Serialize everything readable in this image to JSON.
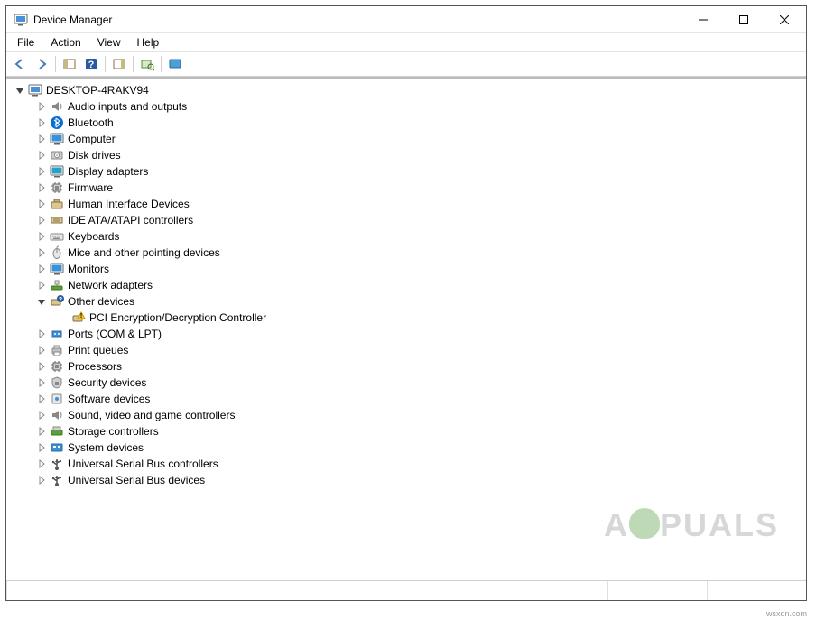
{
  "window": {
    "title": "Device Manager"
  },
  "menu": {
    "file": "File",
    "action": "Action",
    "view": "View",
    "help": "Help"
  },
  "tree": {
    "root": {
      "label": "DESKTOP-4RAKV94",
      "icon": "computer-root"
    },
    "categories": [
      {
        "label": "Audio inputs and outputs",
        "icon": "speaker",
        "expanded": false
      },
      {
        "label": "Bluetooth",
        "icon": "bluetooth",
        "expanded": false
      },
      {
        "label": "Computer",
        "icon": "monitor",
        "expanded": false
      },
      {
        "label": "Disk drives",
        "icon": "disk",
        "expanded": false
      },
      {
        "label": "Display adapters",
        "icon": "display",
        "expanded": false
      },
      {
        "label": "Firmware",
        "icon": "chip",
        "expanded": false
      },
      {
        "label": "Human Interface Devices",
        "icon": "hid",
        "expanded": false
      },
      {
        "label": "IDE ATA/ATAPI controllers",
        "icon": "ide",
        "expanded": false
      },
      {
        "label": "Keyboards",
        "icon": "keyboard",
        "expanded": false
      },
      {
        "label": "Mice and other pointing devices",
        "icon": "mouse",
        "expanded": false
      },
      {
        "label": "Monitors",
        "icon": "monitor",
        "expanded": false
      },
      {
        "label": "Network adapters",
        "icon": "network",
        "expanded": false
      },
      {
        "label": "Other devices",
        "icon": "unknown",
        "expanded": true,
        "children": [
          {
            "label": "PCI Encryption/Decryption Controller",
            "icon": "warning"
          }
        ]
      },
      {
        "label": "Ports (COM & LPT)",
        "icon": "port",
        "expanded": false
      },
      {
        "label": "Print queues",
        "icon": "printer",
        "expanded": false
      },
      {
        "label": "Processors",
        "icon": "cpu",
        "expanded": false
      },
      {
        "label": "Security devices",
        "icon": "security",
        "expanded": false
      },
      {
        "label": "Software devices",
        "icon": "software",
        "expanded": false
      },
      {
        "label": "Sound, video and game controllers",
        "icon": "speaker",
        "expanded": false
      },
      {
        "label": "Storage controllers",
        "icon": "storage",
        "expanded": false
      },
      {
        "label": "System devices",
        "icon": "system",
        "expanded": false
      },
      {
        "label": "Universal Serial Bus controllers",
        "icon": "usb",
        "expanded": false
      },
      {
        "label": "Universal Serial Bus devices",
        "icon": "usb",
        "expanded": false
      }
    ]
  },
  "watermark": "A PUALS",
  "credit": "wsxdn.com"
}
